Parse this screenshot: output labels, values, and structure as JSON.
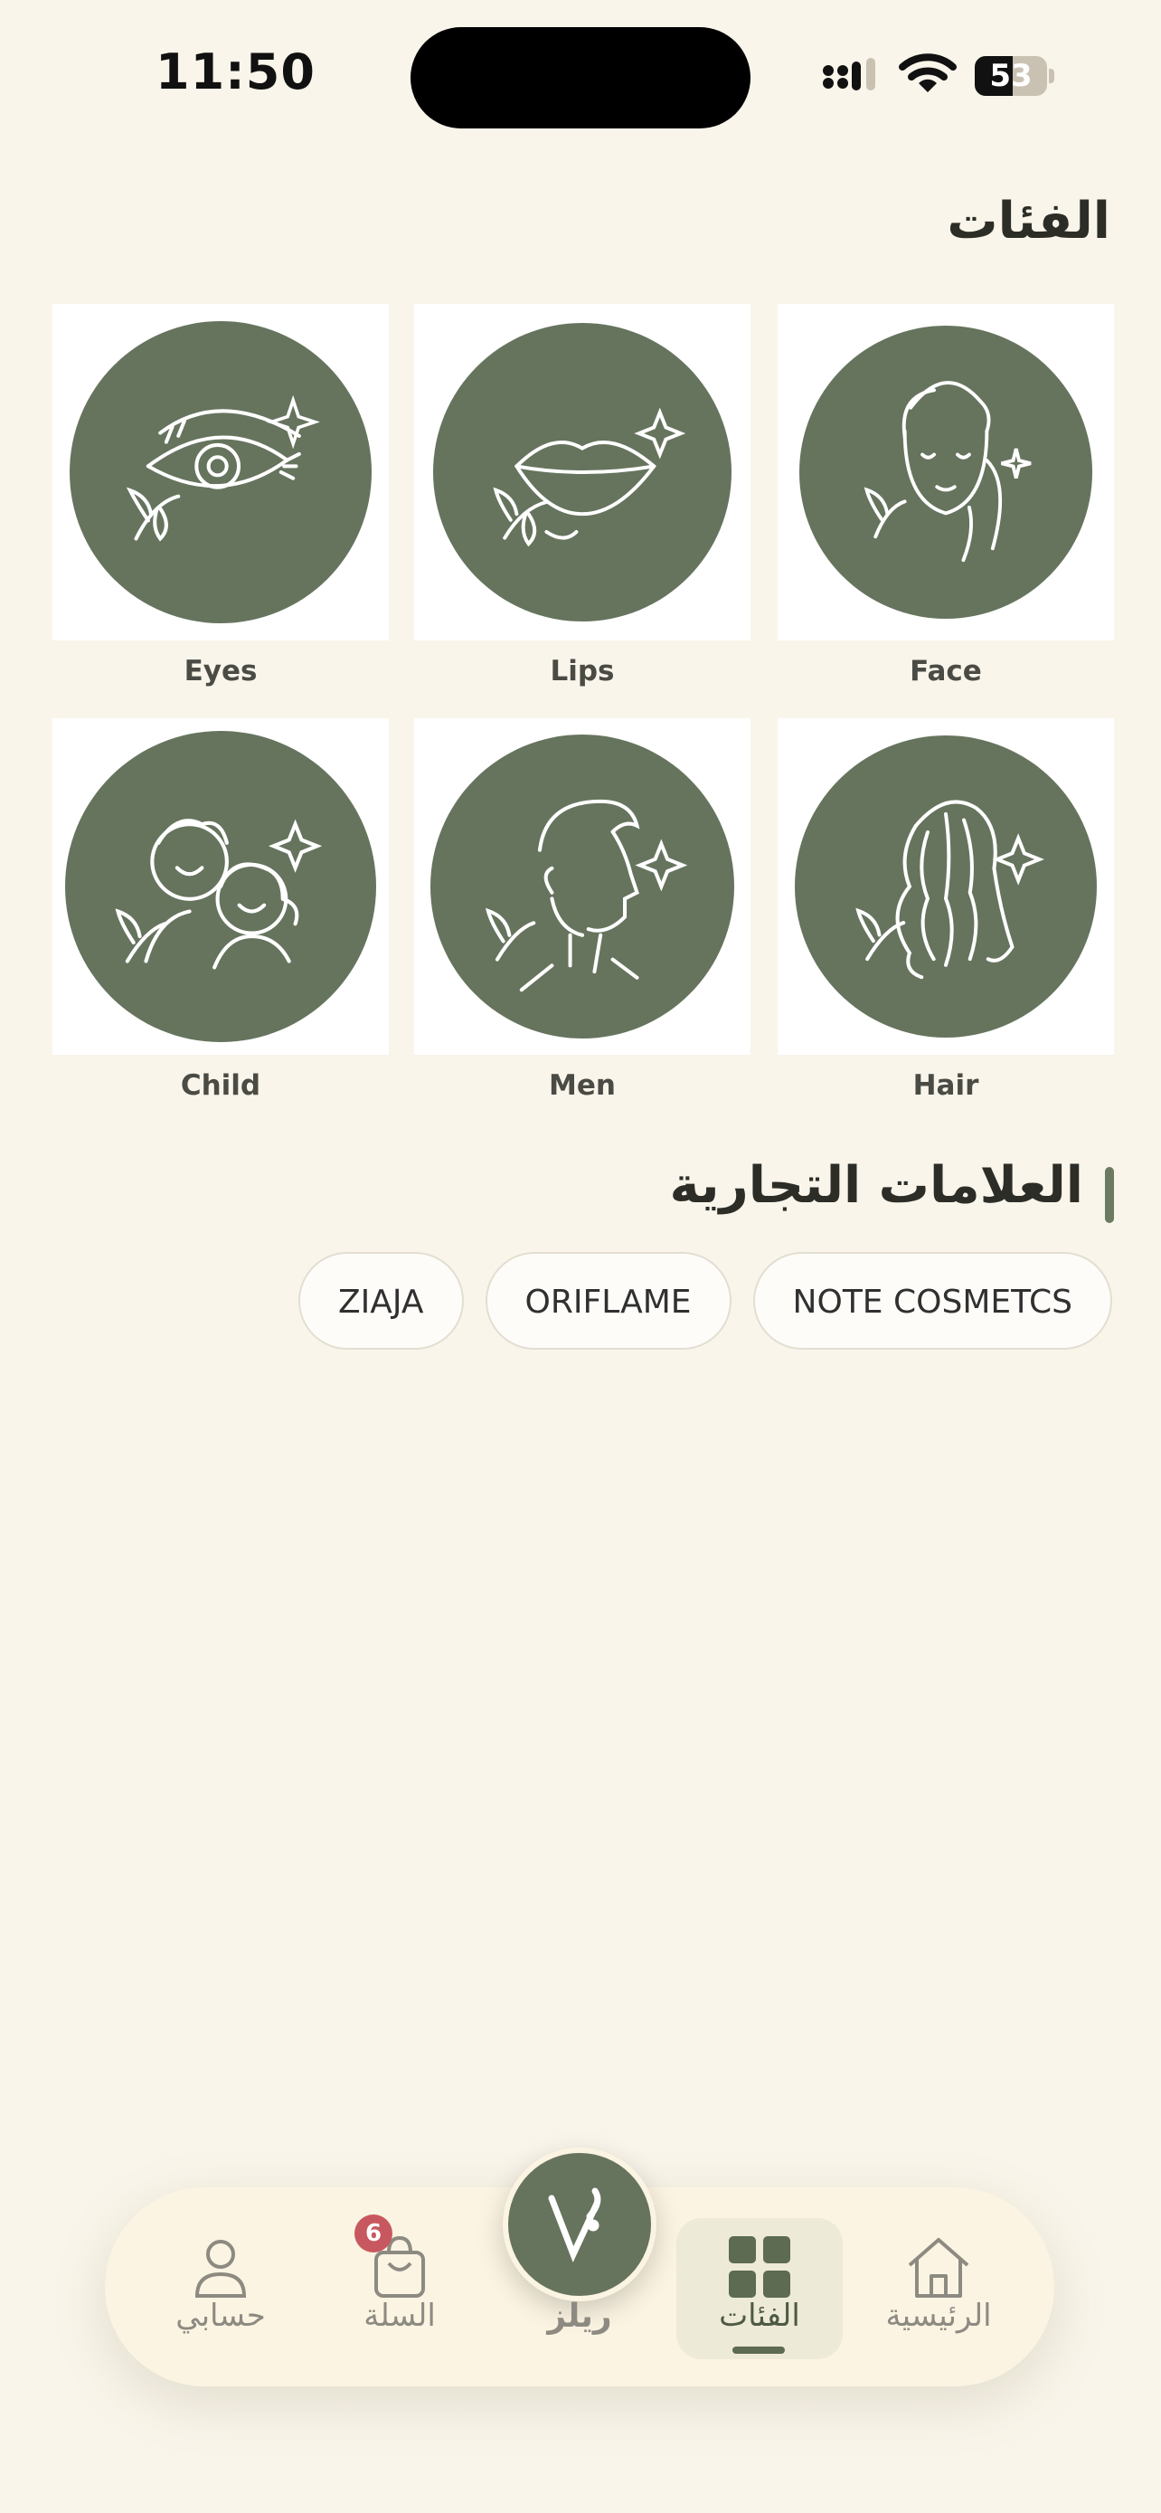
{
  "status_bar": {
    "time": "11:50",
    "battery": "53",
    "battery_level": 0.53
  },
  "sections": {
    "categories_title": "الفئات",
    "brands_title": "العلامات التجارية"
  },
  "categories": [
    {
      "label": "Eyes",
      "icon": "eye-icon"
    },
    {
      "label": "Lips",
      "icon": "lips-icon"
    },
    {
      "label": "Face",
      "icon": "face-icon"
    },
    {
      "label": "Child",
      "icon": "children-icon"
    },
    {
      "label": "Men",
      "icon": "man-profile-icon"
    },
    {
      "label": "Hair",
      "icon": "hair-icon"
    }
  ],
  "brands": [
    "ZIAJA",
    "ORIFLAME",
    "NOTE COSMETCS"
  ],
  "nav": {
    "account": "حسابي",
    "cart": "السلة",
    "cart_badge": "6",
    "reels": "ريلز",
    "categories": "الفئات",
    "home": "الرئيسية",
    "active": "categories"
  },
  "colors": {
    "accent": "#66745e",
    "background": "#f9f5ea",
    "badge": "#c8585f"
  }
}
